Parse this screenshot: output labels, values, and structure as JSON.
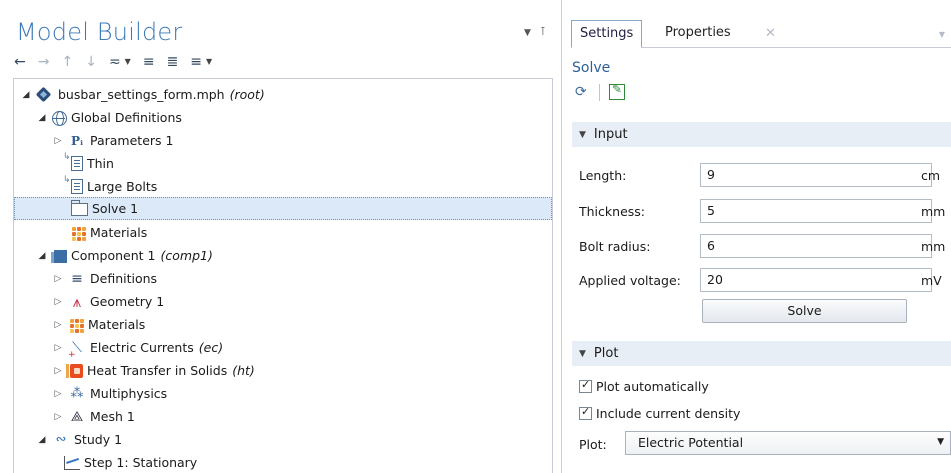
{
  "model_builder": {
    "title": "Model Builder",
    "toolbar": {
      "icons": [
        "back-arrow-icon",
        "forward-arrow-icon",
        "up-arrow-icon",
        "down-arrow-icon",
        "show-icon",
        "collapse-all-icon",
        "expand-all-icon",
        "list-icon"
      ]
    },
    "tree": [
      {
        "label": "busbar_settings_form.mph",
        "tag": "(root)",
        "icon": "model-root-icon",
        "state": "expanded"
      },
      {
        "label": "Global Definitions",
        "tag": "",
        "icon": "globe-icon",
        "state": "expanded"
      },
      {
        "label": "Parameters 1",
        "tag": "",
        "icon": "parameters-icon",
        "state": "collapsed"
      },
      {
        "label": "Thin",
        "tag": "",
        "icon": "parameter-set-icon",
        "state": "leaf"
      },
      {
        "label": "Large Bolts",
        "tag": "",
        "icon": "parameter-set-icon",
        "state": "leaf"
      },
      {
        "label": "Solve 1",
        "tag": "",
        "icon": "folder-icon",
        "state": "selected"
      },
      {
        "label": "Materials",
        "tag": "",
        "icon": "materials-icon",
        "state": "leaf"
      },
      {
        "label": "Component 1",
        "tag": "(comp1)",
        "icon": "component-icon",
        "state": "expanded"
      },
      {
        "label": "Definitions",
        "tag": "",
        "icon": "definitions-icon",
        "state": "collapsed"
      },
      {
        "label": "Geometry 1",
        "tag": "",
        "icon": "geometry-icon",
        "state": "collapsed"
      },
      {
        "label": "Materials",
        "tag": "",
        "icon": "materials-icon",
        "state": "collapsed"
      },
      {
        "label": "Electric Currents",
        "tag": "(ec)",
        "icon": "electric-currents-icon",
        "state": "collapsed"
      },
      {
        "label": "Heat Transfer in Solids",
        "tag": "(ht)",
        "icon": "heat-transfer-icon",
        "state": "collapsed"
      },
      {
        "label": "Multiphysics",
        "tag": "",
        "icon": "multiphysics-icon",
        "state": "collapsed"
      },
      {
        "label": "Mesh 1",
        "tag": "",
        "icon": "mesh-icon",
        "state": "collapsed"
      },
      {
        "label": "Study 1",
        "tag": "",
        "icon": "study-icon",
        "state": "expanded"
      },
      {
        "label": "Step 1: Stationary",
        "tag": "",
        "icon": "stationary-step-icon",
        "state": "leaf"
      }
    ]
  },
  "settings": {
    "tabs": [
      {
        "label": "Settings",
        "active": true
      },
      {
        "label": "Properties",
        "active": false
      }
    ],
    "title": "Solve",
    "input_section": "Input",
    "fields": [
      {
        "label": "Length:",
        "value": "9",
        "unit": "cm"
      },
      {
        "label": "Thickness:",
        "value": "5",
        "unit": "mm"
      },
      {
        "label": "Bolt radius:",
        "value": "6",
        "unit": "mm"
      },
      {
        "label": "Applied voltage:",
        "value": "20",
        "unit": "mV"
      }
    ],
    "solve_button": "Solve",
    "plot_section": "Plot",
    "checkboxes": [
      {
        "label": "Plot automatically",
        "checked": true
      },
      {
        "label": "Include current density",
        "checked": true
      }
    ],
    "plot_label": "Plot:",
    "plot_value": "Electric Potential"
  },
  "colors": {
    "title_blue": "#3d7ab8",
    "selection": "#dbe9f8",
    "section_bg": "#e8eef5"
  }
}
